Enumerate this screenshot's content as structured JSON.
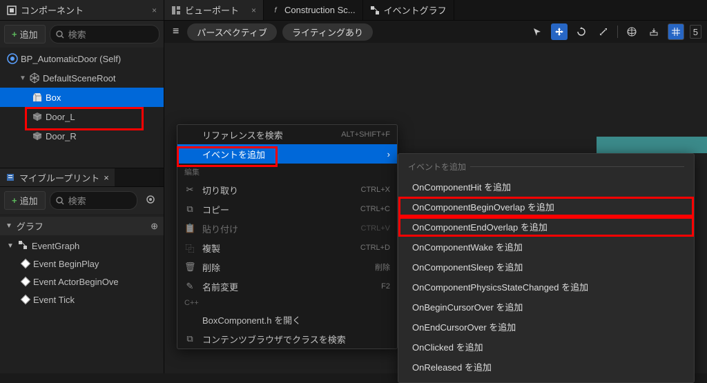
{
  "tabs": {
    "components": {
      "label": "コンポーネント"
    },
    "viewport": {
      "label": "ビューポート"
    },
    "construction": {
      "prefix": "f",
      "label": "Construction Sc..."
    },
    "eventgraph": {
      "label": "イベントグラフ"
    }
  },
  "sidebar": {
    "add_label": "追加",
    "search_placeholder": "検索",
    "tree": {
      "root": "BP_AutomaticDoor (Self)",
      "scene_root": "DefaultSceneRoot",
      "box": "Box",
      "door_l": "Door_L",
      "door_r": "Door_R"
    },
    "myblueprint_tab": "マイブループリント",
    "graph_section": "グラフ",
    "event_graph": "EventGraph",
    "events": {
      "begin_play": "Event BeginPlay",
      "actor_begin_overlap": "Event ActorBeginOve",
      "tick": "Event Tick"
    }
  },
  "viewport": {
    "perspective": "パースペクティブ",
    "lighting": "ライティングあり",
    "snap_value": "5"
  },
  "context_menu": {
    "search_ref": {
      "label": "リファレンスを検索",
      "hint": "ALT+SHIFT+F"
    },
    "add_event": "イベントを追加",
    "sect_edit": "編集",
    "cut": {
      "label": "切り取り",
      "hint": "CTRL+X"
    },
    "copy": {
      "label": "コピー",
      "hint": "CTRL+C"
    },
    "paste": {
      "label": "貼り付け",
      "hint": "CTRL+V"
    },
    "duplicate": {
      "label": "複製",
      "hint": "CTRL+D"
    },
    "delete": {
      "label": "削除",
      "hint": "削除"
    },
    "rename": {
      "label": "名前変更",
      "hint": "F2"
    },
    "sect_cpp": "C++",
    "open_header": "BoxComponent.h を開く",
    "find_class": "コンテンツブラウザでクラスを検索"
  },
  "submenu": {
    "header": "イベントを追加",
    "items": [
      "OnComponentHit を追加",
      "OnComponentBeginOverlap を追加",
      "OnComponentEndOverlap を追加",
      "OnComponentWake を追加",
      "OnComponentSleep を追加",
      "OnComponentPhysicsStateChanged を追加",
      "OnBeginCursorOver を追加",
      "OnEndCursorOver を追加",
      "OnClicked を追加",
      "OnReleased を追加"
    ]
  }
}
